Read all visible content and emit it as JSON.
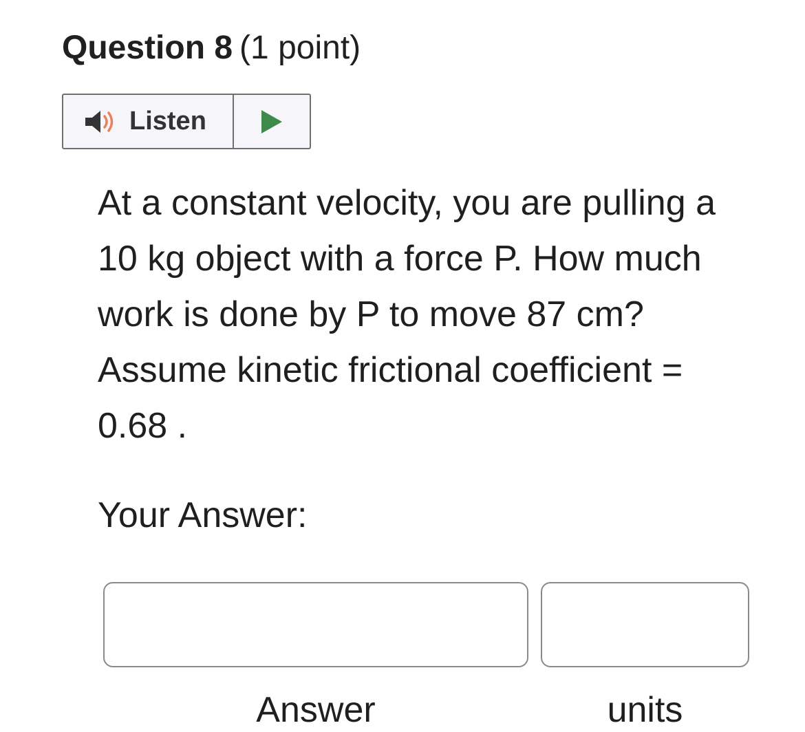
{
  "question": {
    "number_label": "Question 8",
    "points_label": "(1 point)"
  },
  "listen": {
    "label": "Listen",
    "speaker_icon": "speaker-icon",
    "play_icon": "play-icon",
    "speaker_color": "#333333",
    "wave_color": "#e8825a",
    "play_color": "#3f8a4b"
  },
  "prompt": {
    "text": "At a constant velocity, you are pulling a 10 kg object with a force P. How much work is done by P to move 87 cm? Assume kinetic frictional coefficient = 0.68 ."
  },
  "answer_section": {
    "heading": "Your Answer:",
    "answer_value": "",
    "units_value": "",
    "answer_caption": "Answer",
    "units_caption": "units"
  }
}
